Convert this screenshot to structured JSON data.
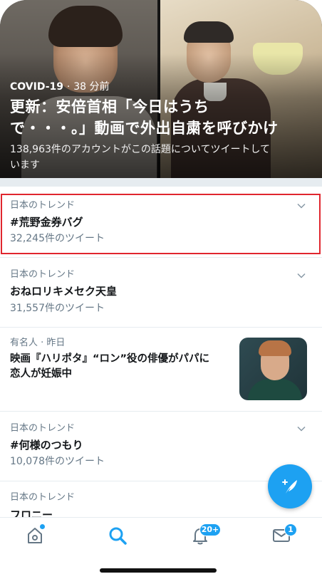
{
  "hero": {
    "category": "COVID-19",
    "separator": "·",
    "time": "38 分前",
    "title_line1": "更新：安倍首相「今日はうち",
    "title_line2": "で・・・。」動画で外出自粛を呼びかけ",
    "subtitle_line1": "138,963件のアカウントがこの話題についてツイートして",
    "subtitle_line2": "います"
  },
  "trends": [
    {
      "context": "日本のトレンド",
      "name": "#荒野金券バグ",
      "count": "32,245件のツイート"
    },
    {
      "context": "日本のトレンド",
      "name": "おねロリキメセク天皇",
      "count": "31,557件のツイート"
    },
    {
      "context": "日本のトレンド",
      "name": "#何様のつもり",
      "count": "10,078件のツイート"
    },
    {
      "context": "日本のトレンド",
      "name": "フロニー"
    }
  ],
  "news_item": {
    "context": "有名人 · 昨日",
    "headline_line1": "映画『ハリポタ』“ロン”役の俳優がパパに",
    "headline_line2": "恋人が妊娠中"
  },
  "tabbar": {
    "notifications_badge": "20+",
    "messages_badge": "1"
  },
  "colors": {
    "accent": "#1da1f2",
    "highlight_border": "#e0262e",
    "secondary_text": "#657786"
  }
}
